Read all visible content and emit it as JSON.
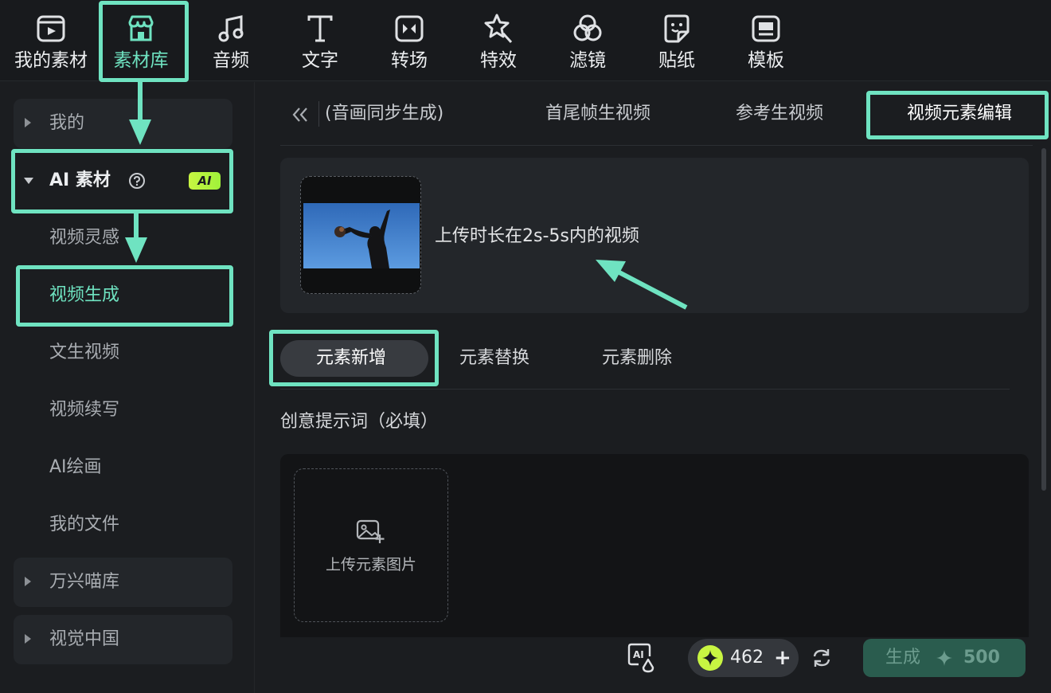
{
  "toolbar": {
    "items": [
      {
        "label": "我的素材",
        "icon": "my-media-icon"
      },
      {
        "label": "素材库",
        "icon": "store-icon"
      },
      {
        "label": "音频",
        "icon": "music-note-icon"
      },
      {
        "label": "文字",
        "icon": "text-t-icon"
      },
      {
        "label": "转场",
        "icon": "transition-icon"
      },
      {
        "label": "特效",
        "icon": "star-wand-icon"
      },
      {
        "label": "滤镜",
        "icon": "filter-circles-icon"
      },
      {
        "label": "贴纸",
        "icon": "sticker-icon"
      },
      {
        "label": "模板",
        "icon": "template-icon"
      }
    ],
    "active": "素材库"
  },
  "sidebar": {
    "groups": {
      "mine": "我的",
      "ai": "AI 素材",
      "ai_badge": "AI",
      "wanxing": "万兴喵库",
      "vcg": "视觉中国"
    },
    "ai_items": [
      {
        "label": "视频灵感"
      },
      {
        "label": "视频生成",
        "active": true
      },
      {
        "label": "文生视频"
      },
      {
        "label": "视频续写"
      },
      {
        "label": "AI绘画"
      },
      {
        "label": "我的文件"
      }
    ]
  },
  "main": {
    "tabs": [
      {
        "label": "(音画同步生成)"
      },
      {
        "label": "首尾帧生视频"
      },
      {
        "label": "参考生视频"
      },
      {
        "label": "视频元素编辑",
        "active": true
      }
    ],
    "upload_hint": "上传时长在2s-5s内的视频",
    "modes": [
      {
        "label": "元素新增",
        "active": true
      },
      {
        "label": "元素替换"
      },
      {
        "label": "元素删除"
      }
    ],
    "prompt_label": "创意提示词（必填）",
    "element_upload_label": "上传元素图片"
  },
  "bottom_bar": {
    "credits": "462",
    "generate_label": "生成",
    "generate_cost": "500"
  },
  "colors": {
    "accent": "#6fe3c1",
    "ai_badge": "#c8f542",
    "background": "#1b1d20",
    "generate_button": "#2a5c4e"
  }
}
